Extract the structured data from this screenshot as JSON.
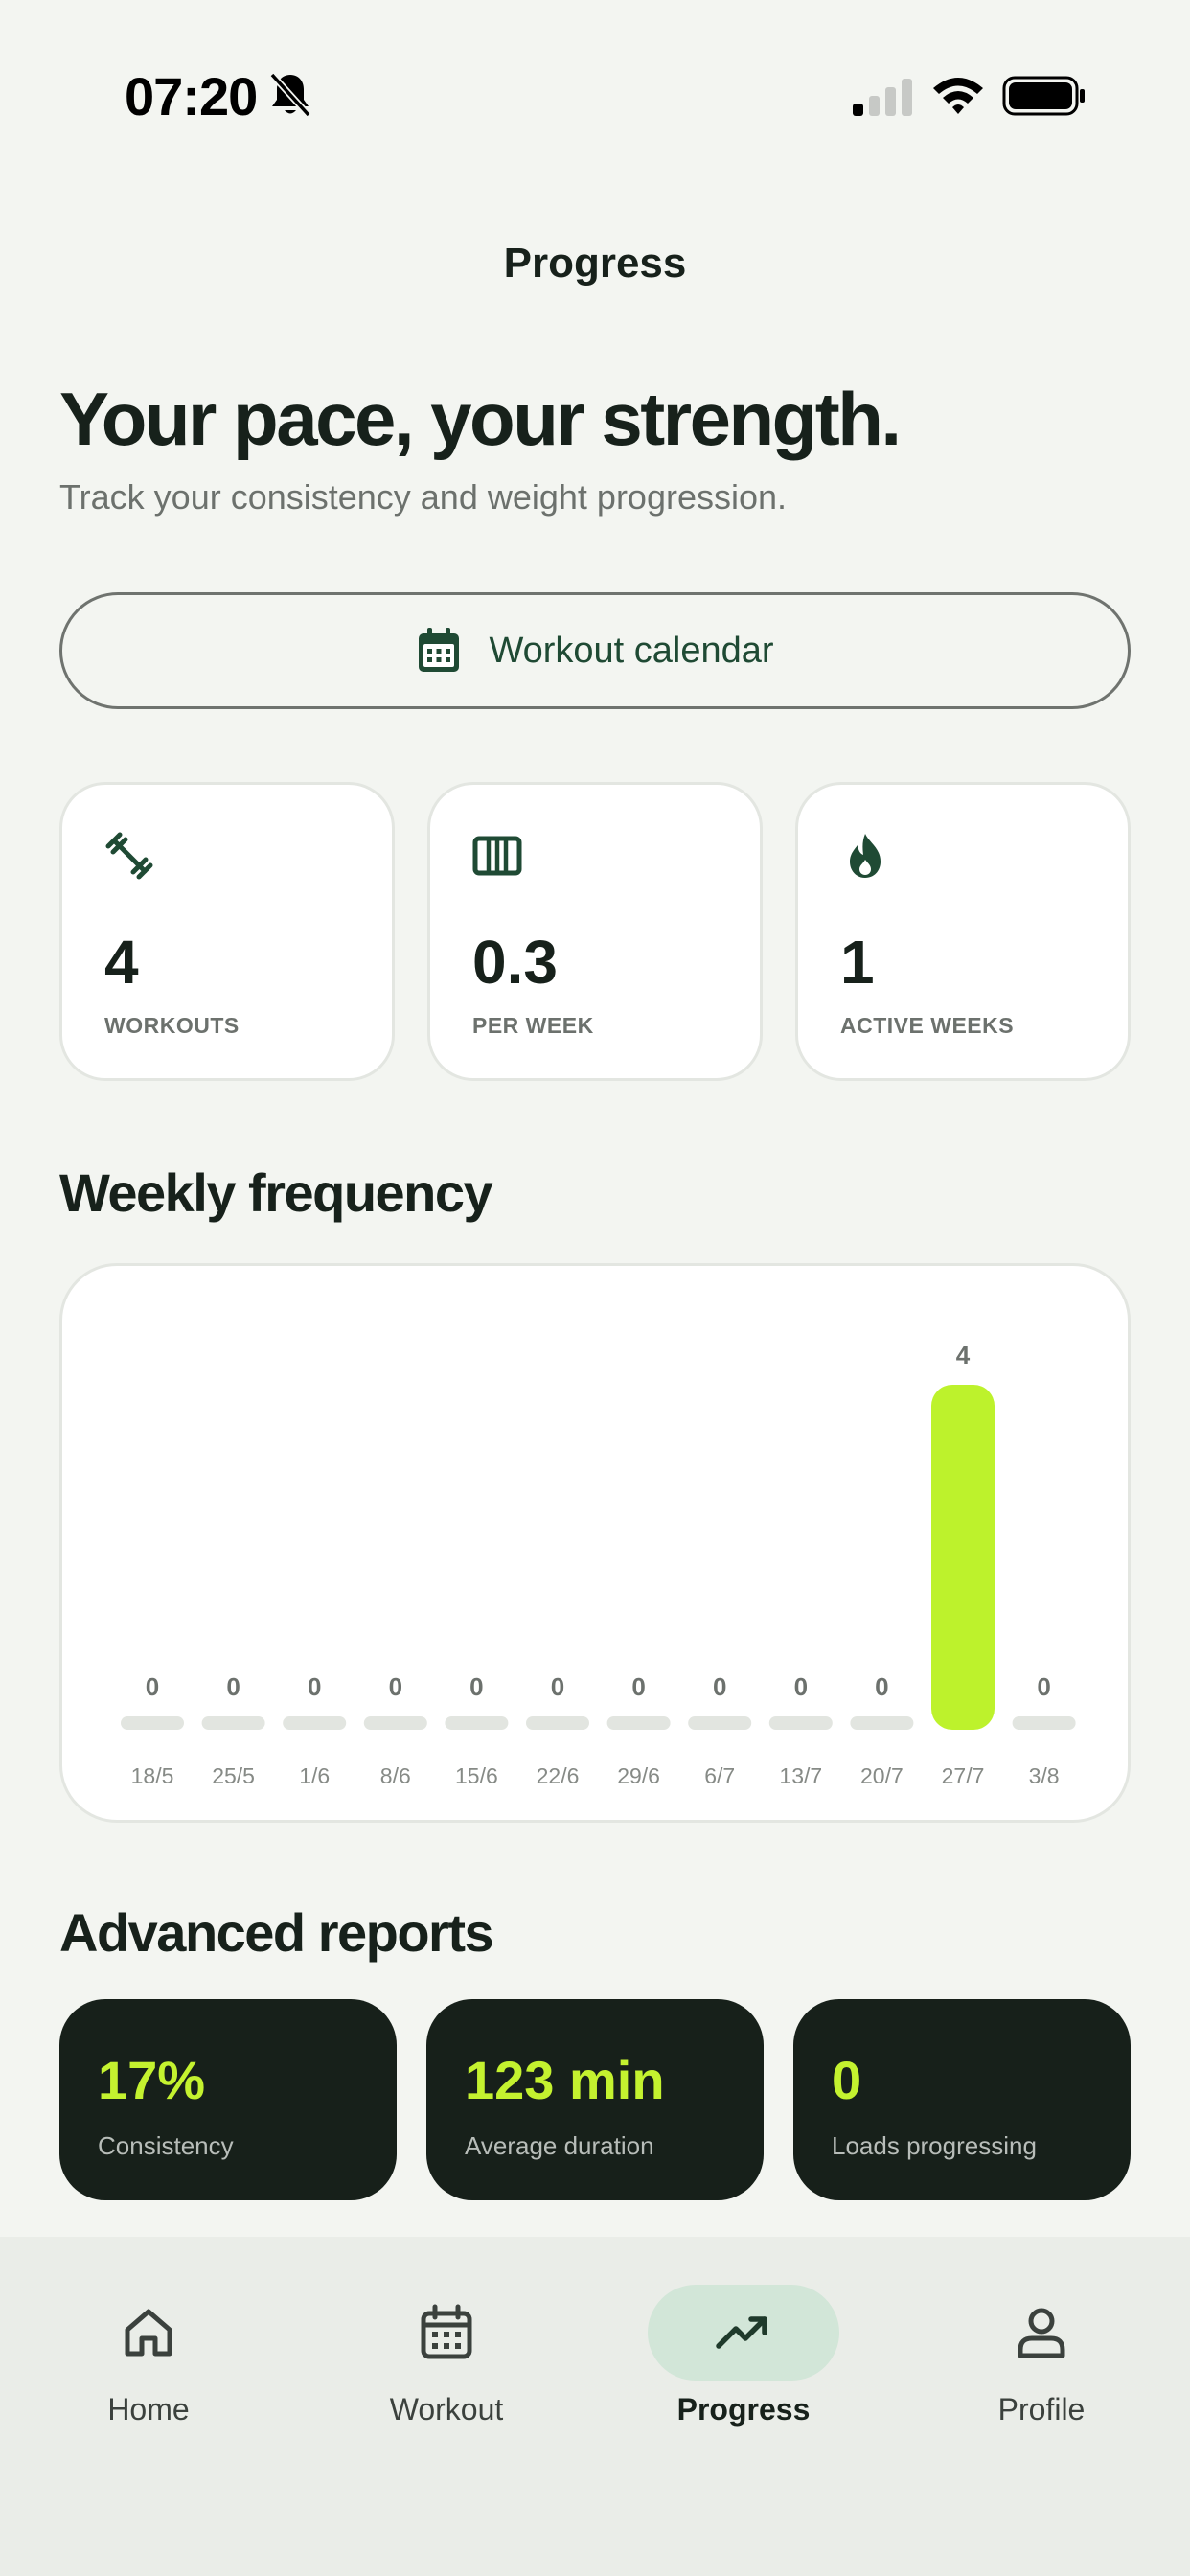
{
  "status_bar": {
    "time": "07:20"
  },
  "header": {
    "title": "Progress"
  },
  "hero": {
    "headline": "Your pace, your strength.",
    "subtitle": "Track your consistency and weight progression."
  },
  "calendar_button": {
    "label": "Workout calendar",
    "icon": "calendar-icon"
  },
  "stats": [
    {
      "icon": "dumbbell-icon",
      "value": "4",
      "label": "WORKOUTS"
    },
    {
      "icon": "bars-icon",
      "value": "0.3",
      "label": "PER WEEK"
    },
    {
      "icon": "flame-icon",
      "value": "1",
      "label": "ACTIVE WEEKS"
    }
  ],
  "weekly": {
    "title": "Weekly frequency"
  },
  "chart_data": {
    "type": "bar",
    "categories": [
      "18/5",
      "25/5",
      "1/6",
      "8/6",
      "15/6",
      "22/6",
      "29/6",
      "6/7",
      "13/7",
      "20/7",
      "27/7",
      "3/8"
    ],
    "values": [
      0,
      0,
      0,
      0,
      0,
      0,
      0,
      0,
      0,
      0,
      4,
      0
    ],
    "ylim": [
      0,
      4
    ],
    "colors": {
      "active": "#bdf22c",
      "empty": "#e2e5e0"
    }
  },
  "reports": {
    "title": "Advanced reports",
    "items": [
      {
        "value": "17%",
        "label": "Consistency"
      },
      {
        "value": "123 min",
        "label": "Average duration"
      },
      {
        "value": "0",
        "label": "Loads progressing"
      }
    ]
  },
  "tabs": [
    {
      "label": "Home",
      "icon": "home-icon",
      "active": false
    },
    {
      "label": "Workout",
      "icon": "calendar-icon",
      "active": false
    },
    {
      "label": "Progress",
      "icon": "trending-up-icon",
      "active": true
    },
    {
      "label": "Profile",
      "icon": "user-icon",
      "active": false
    }
  ],
  "colors": {
    "accent": "#c4f22f",
    "dark": "#17201a",
    "brand_green": "#1f4a34"
  }
}
